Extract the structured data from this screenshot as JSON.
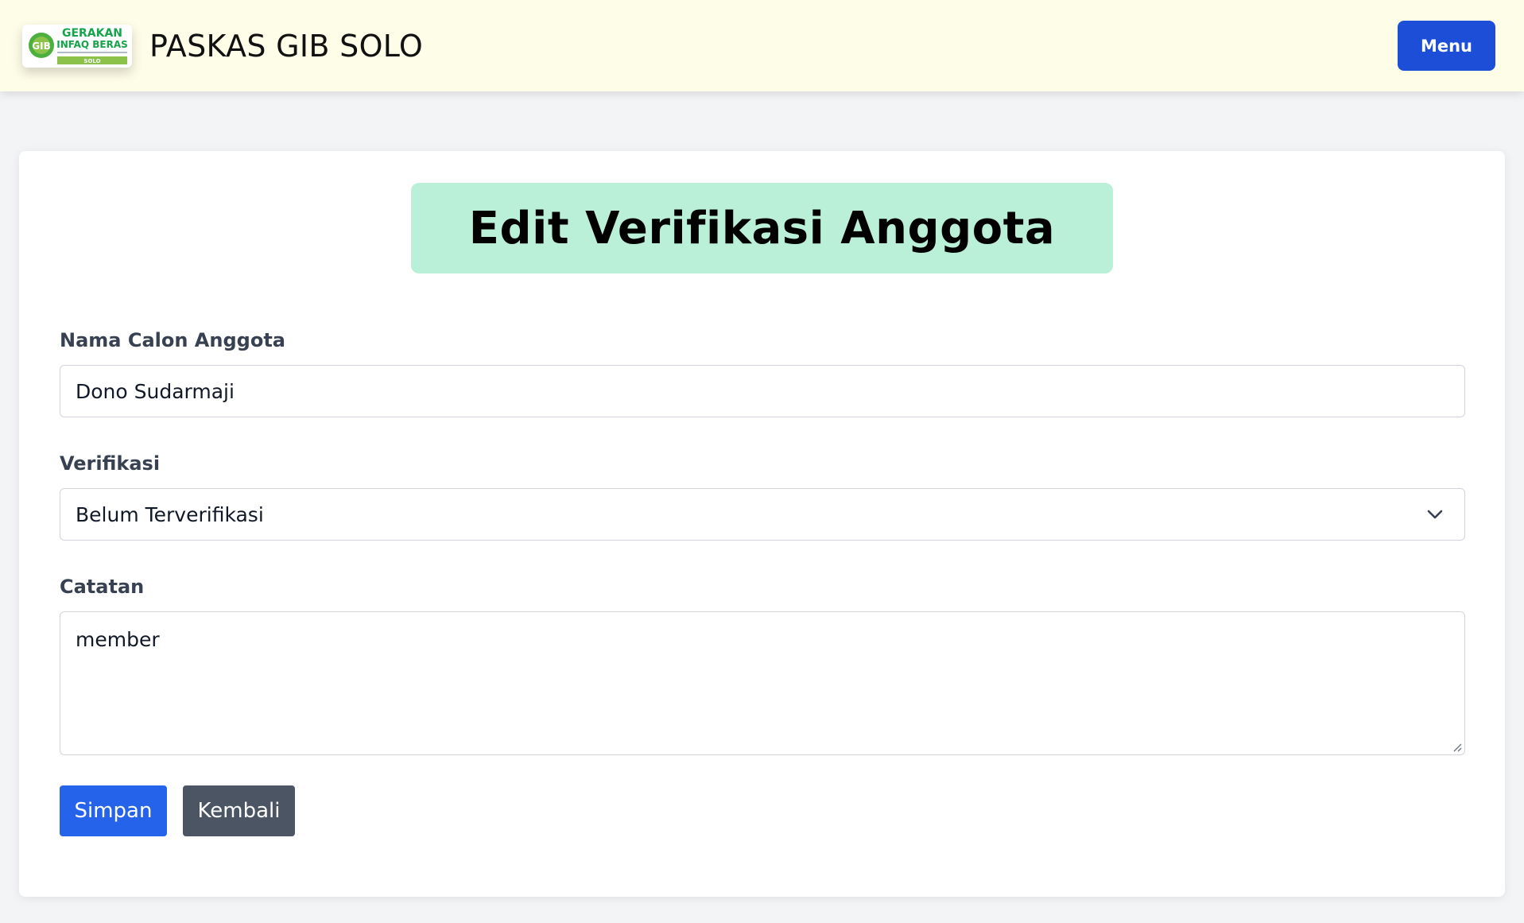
{
  "navbar": {
    "logo": {
      "line1": "GERAKAN",
      "line2": "INFAQ BERAS",
      "tagline": "",
      "city": "SOLO",
      "emblem": "GIB"
    },
    "brand_title": "PASKAS GIB SOLO",
    "menu_label": "Menu"
  },
  "form": {
    "title": "Edit Verifikasi Anggota",
    "name_label": "Nama Calon Anggota",
    "name_value": "Dono Sudarmaji",
    "verification_label": "Verifikasi",
    "verification_selected": "Belum Terverifikasi",
    "notes_label": "Catatan",
    "notes_value": "member",
    "save_label": "Simpan",
    "back_label": "Kembali"
  },
  "icons": {
    "select_arrow": "chevron-down-icon",
    "textarea_resize": "resize-handle-icon"
  },
  "colors": {
    "navbar_bg": "#fefde7",
    "menu_button": "#1d4ed8",
    "title_bg": "#bbf0d8",
    "save_button": "#2563eb",
    "back_button": "#4b5563",
    "logo_green": "#16a34a"
  }
}
